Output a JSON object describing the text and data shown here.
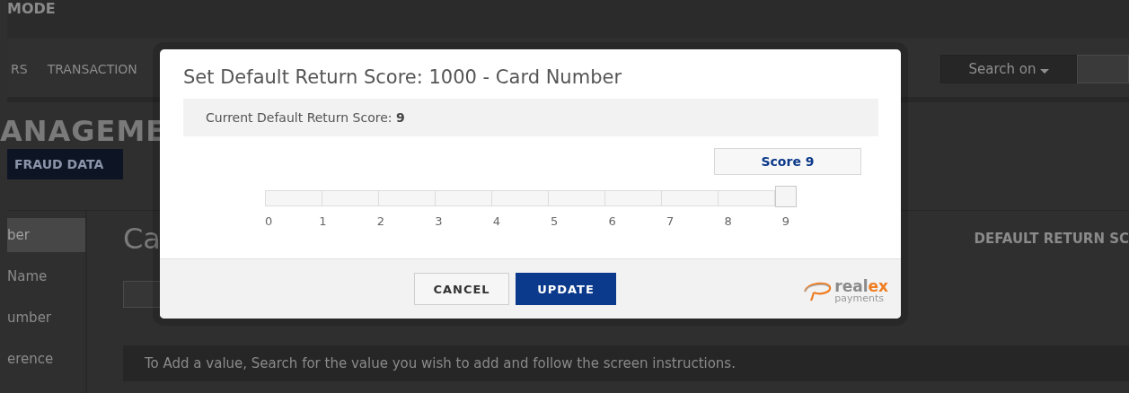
{
  "header": {
    "title": "MODE"
  },
  "nav": {
    "items": [
      {
        "label": "RS"
      },
      {
        "label": "TRANSACTION"
      }
    ],
    "search_menu": {
      "label": "Search on"
    }
  },
  "page_title": "ANAGEME",
  "fraud_data_button": {
    "label": "FRAUD DATA"
  },
  "sidebar": {
    "items": [
      {
        "label": "ber",
        "selected": true
      },
      {
        "label": "Name",
        "selected": false
      },
      {
        "label": "umber",
        "selected": false
      },
      {
        "label": "erence",
        "selected": false
      }
    ]
  },
  "content": {
    "heading": "Ca",
    "column_heading": "DEFAULT RETURN SC",
    "info": "To Add a value, Search for the value you wish to add and follow the screen instructions."
  },
  "modal": {
    "title": "Set Default Return Score: 1000 - Card Number",
    "current": "Current Default Return Score: **9**",
    "slider": {
      "level": 1.0,
      "tooltip": "Score 9",
      "ticks": [
        "0",
        "1",
        "2",
        "3",
        "4",
        "5",
        "6",
        "7",
        "8",
        "9"
      ]
    },
    "buttons": [
      {
        "label": "CANCEL",
        "kind": "secondary"
      },
      {
        "label": "UPDATE",
        "kind": "primary"
      }
    ],
    "logo": {
      "name_parts": [
        "real",
        "ex"
      ],
      "tagline": "payments"
    }
  }
}
